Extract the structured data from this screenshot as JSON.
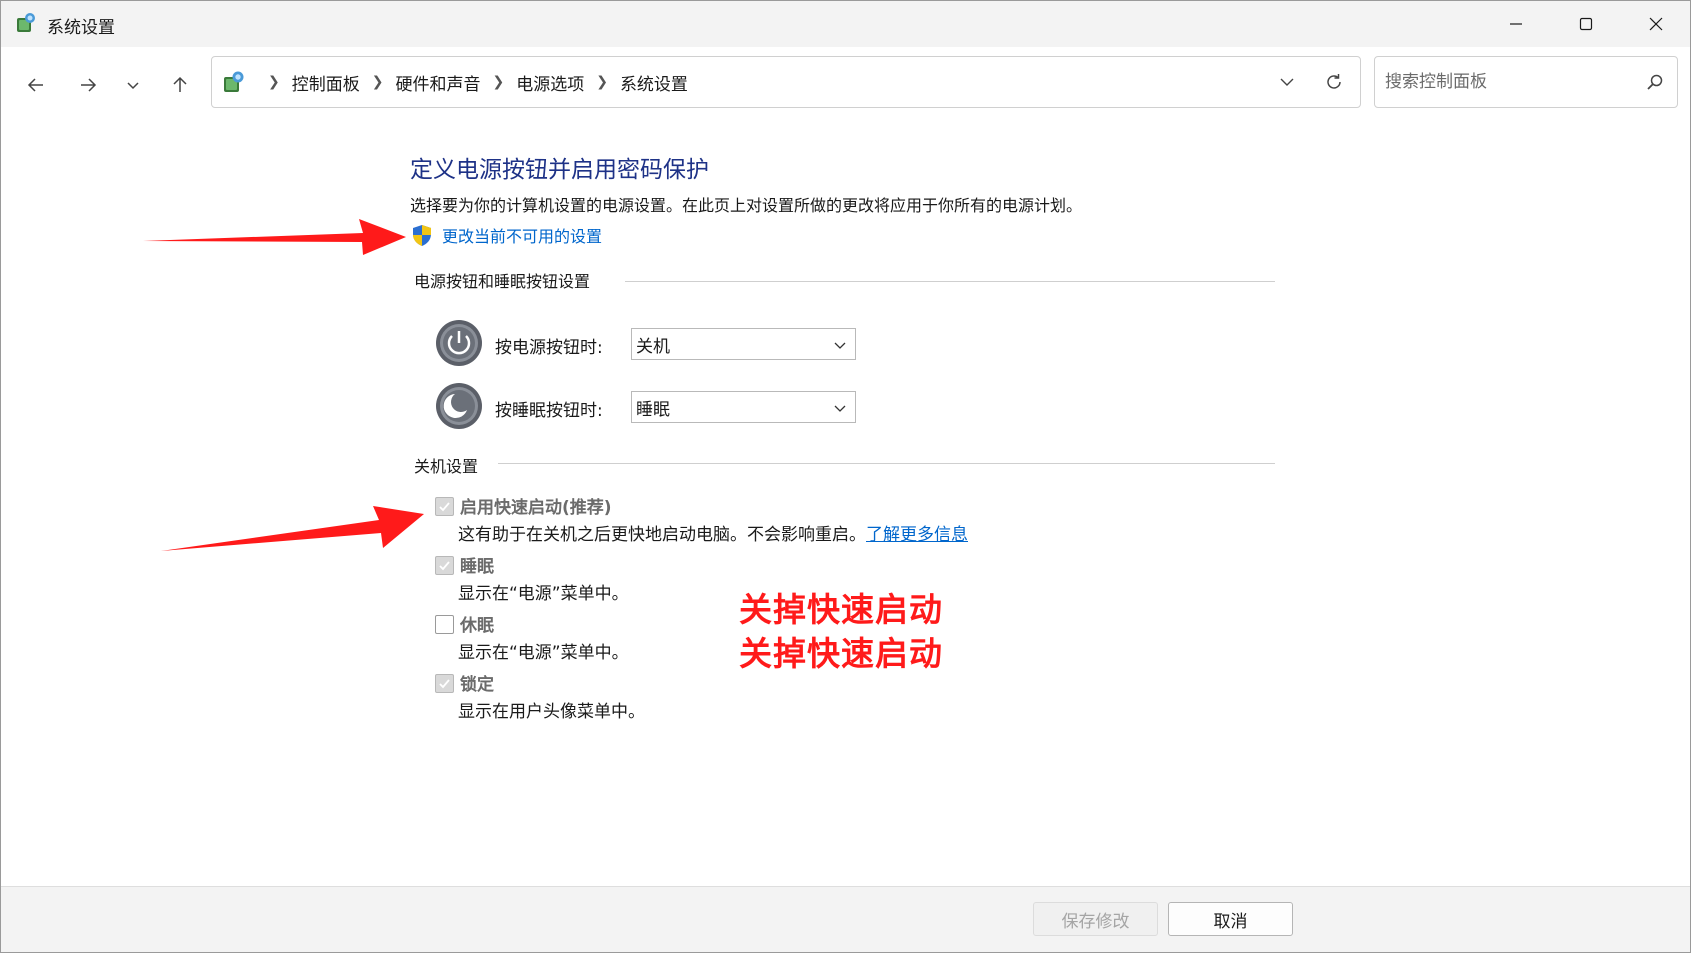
{
  "window": {
    "title": "系统设置",
    "minimize_label": "Minimize",
    "maximize_label": "Maximize",
    "close_label": "Close"
  },
  "nav": {
    "breadcrumb": [
      "控制面板",
      "硬件和声音",
      "电源选项",
      "系统设置"
    ],
    "search_placeholder": "搜索控制面板"
  },
  "main": {
    "title": "定义电源按钮并启用密码保护",
    "description": "选择要为你的计算机设置的电源设置。在此页上对设置所做的更改将应用于你所有的电源计划。",
    "change_link": "更改当前不可用的设置",
    "power_section": {
      "label": "电源按钮和睡眠按钮设置",
      "rows": [
        {
          "label": "按电源按钮时:",
          "value": "关机",
          "icon": "power-button-icon"
        },
        {
          "label": "按睡眠按钮时:",
          "value": "睡眠",
          "icon": "sleep-button-icon"
        }
      ]
    },
    "shutdown_section": {
      "label": "关机设置",
      "items": [
        {
          "label": "启用快速启动(推荐)",
          "checked": true,
          "desc": "这有助于在关机之后更快地启动电脑。不会影响重启。",
          "link": "了解更多信息"
        },
        {
          "label": "睡眠",
          "checked": true,
          "desc": "显示在“电源”菜单中。"
        },
        {
          "label": "休眠",
          "checked": false,
          "desc": "显示在“电源”菜单中。"
        },
        {
          "label": "锁定",
          "checked": true,
          "desc": "显示在用户头像菜单中。"
        }
      ]
    },
    "annotation": [
      "关掉快速启动",
      "关掉快速启动"
    ]
  },
  "footer": {
    "save_label": "保存修改",
    "cancel_label": "取消"
  },
  "colors": {
    "title_blue": "#1e3287",
    "link_blue": "#0066cc",
    "annotation_red": "#ff1a1a",
    "titlebar_bg": "#f3f3f3"
  }
}
